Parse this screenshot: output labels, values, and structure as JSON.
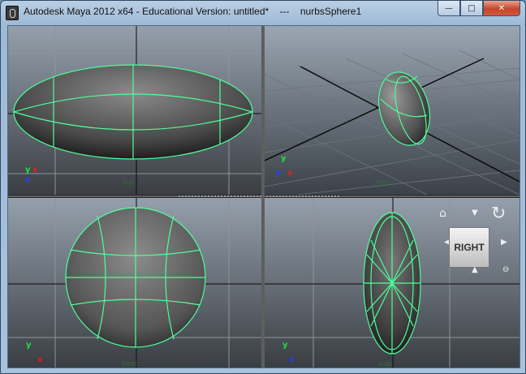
{
  "window": {
    "title": "Autodesk Maya 2012 x64 - Educational Version: untitled*    ---    nurbsSphere1",
    "minimize_glyph": "—",
    "maximize_glyph": "□",
    "close_glyph": "✕"
  },
  "viewports": [
    {
      "id": "top",
      "label": "top",
      "axes": [
        "y",
        "x"
      ]
    },
    {
      "id": "persp",
      "label": "persp",
      "axes": [
        "y",
        "x"
      ]
    },
    {
      "id": "front",
      "label": "front",
      "axes": [
        "y",
        "x"
      ]
    },
    {
      "id": "side",
      "label": "side",
      "axes": [
        "y",
        "z"
      ]
    }
  ],
  "view_cube": {
    "face_label": "RIGHT",
    "home_icon": "home-icon",
    "rotate_icon": "rotate-arrow-icon",
    "menu_icon": "menu-circle-icon"
  },
  "colors": {
    "wireframe": "#4dff9a",
    "grid": "#8a8f96",
    "grid_axis": "#0a0a0a",
    "axis_x": "#e02020",
    "axis_y": "#20e040",
    "axis_z": "#2040ff"
  }
}
